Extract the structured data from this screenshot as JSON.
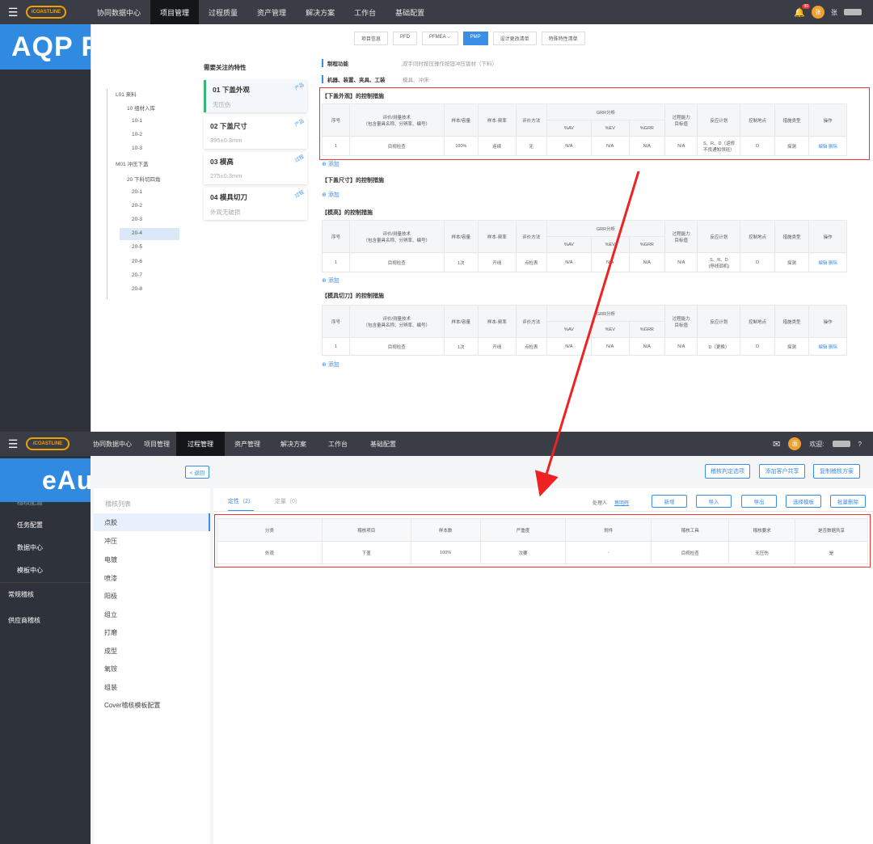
{
  "screen1": {
    "brand_text": "iCOASTLINE",
    "nav": [
      "协同数据中心",
      "项目管理",
      "过程质量",
      "资产管理",
      "解决方案",
      "工作台",
      "基础配置"
    ],
    "notif_count": "99",
    "avatar": "张",
    "username": "张",
    "tag": "AQP PFMEA",
    "tabs": [
      "项目信息",
      "PFD",
      "PFMEA ⌵",
      "PMP",
      "设计更改清单",
      "特殊特性清单"
    ],
    "tree": [
      "L01 来料",
      "10 组材入库",
      "10-1",
      "10-2",
      "10-3",
      "M01 冲压下盖",
      "20 下料切四角",
      "20-1",
      "20-2",
      "20-3",
      "20-4",
      "20-5",
      "20-6",
      "20-7",
      "20-8"
    ],
    "focus_title": "需要关注的特性",
    "chars": [
      {
        "title": "01 下盖外观",
        "sub": "无压伤",
        "flag": "产品"
      },
      {
        "title": "02 下盖尺寸",
        "sub": "395±0.3mm",
        "flag": "产品"
      },
      {
        "title": "03 模高",
        "sub": "275±0.3mm",
        "flag": "过程"
      },
      {
        "title": "04 模具切刀",
        "sub": "外观无破损",
        "flag": "过程"
      }
    ],
    "proc_func_label": "制程功能",
    "proc_func_value": "双手同时按压操作按钮冲压钣材（下料）",
    "machine_label": "机器、装置、夹具、工装",
    "machine_value": "模具、冲床",
    "sections": [
      "【下盖外观】的控制措施",
      "【下盖尺寸】的控制措施",
      "【模高】的控制措施",
      "【模具切刀】的控制措施"
    ],
    "add_label": "添加",
    "headers": {
      "seq": "序号",
      "tech": "评价/测量技术\n（包含量具名称、分辨率、编号）",
      "sample": "样本/容量",
      "freq": "样本-频率",
      "method": "评价方法",
      "grr": "GRR分析",
      "av": "%AV",
      "ev": "%EV",
      "pgrr": "%GRR",
      "cap": "过程能力\n目标值",
      "react": "反应计划",
      "ctrl": "控制地点",
      "type": "措施类型",
      "op": "操作"
    },
    "rows": [
      {
        "seq": "1",
        "tech": "目视检查",
        "sample": "100%",
        "freq": "连续",
        "method": "无",
        "av": "N/A",
        "ev": "N/A",
        "grr": "N/A",
        "cap": "N/A",
        "react": "S、R、D（返修\n不良通知领班）",
        "ctrl": "D",
        "type": "探测",
        "edit": "编辑",
        "del": "删除"
      },
      {
        "seq": "1",
        "tech": "目视检查",
        "sample": "1次",
        "freq": "开线",
        "method": "点检表",
        "av": "N/A",
        "ev": "N/A",
        "grr": "N/A",
        "cap": "N/A",
        "react": "S、R、D\n(停线调机)",
        "ctrl": "D",
        "type": "探测",
        "edit": "编辑",
        "del": "删除"
      },
      {
        "seq": "1",
        "tech": "目视检查",
        "sample": "1次",
        "freq": "开线",
        "method": "点检表",
        "av": "N/A",
        "ev": "N/A",
        "grr": "N/A",
        "cap": "N/A",
        "react": "D（更换）",
        "ctrl": "D",
        "type": "探测",
        "edit": "编辑",
        "del": "删除"
      }
    ]
  },
  "screen2": {
    "brand_text": "iCOASTLINE",
    "nav": [
      "协同数据中心",
      "项目管理",
      "过程管理",
      "资产管理",
      "解决方案",
      "工作台",
      "基础配置"
    ],
    "welcome": "欢迎:",
    "avatar": "面",
    "tag": "eAudit",
    "side": [
      "稽核配置",
      "任务配置",
      "数据中心",
      "模板中心",
      "常规稽核",
      "供应商稽核"
    ],
    "back": "< 返回",
    "top_btns": [
      "稽核判定选项",
      "添加客户共享",
      "复制稽核方案"
    ],
    "cat_header": "稽核列表",
    "cats": [
      "点胶",
      "冲压",
      "电镀",
      "喷漆",
      "阳极",
      "组立",
      "打磨",
      "成型",
      "氧铵",
      "组装",
      "Cover稽核模板配置"
    ],
    "tab_qual": "定性（2）",
    "tab_quant": "定量（0）",
    "handler_label": "处理人",
    "handler_name": "蔡明辉",
    "btns": [
      "新增",
      "导入",
      "导出",
      "选择模板",
      "批量删除"
    ],
    "headers": [
      "分类",
      "稽核项目",
      "样本数",
      "严重度",
      "附件",
      "稽核工具",
      "稽核要求",
      "是否数据共享"
    ],
    "row": [
      "外观",
      "下盖",
      "100%",
      "次要",
      "-",
      "目视检查",
      "无压伤",
      "是"
    ]
  }
}
